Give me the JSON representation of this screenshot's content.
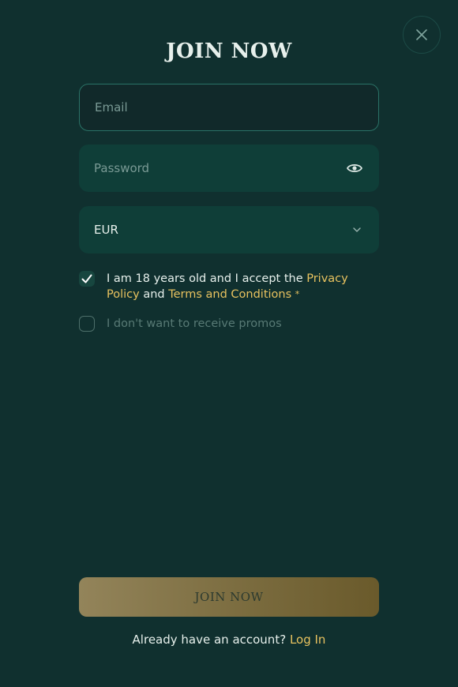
{
  "modal": {
    "title": "JOIN NOW",
    "close_icon": "close-icon"
  },
  "form": {
    "email": {
      "placeholder": "Email",
      "value": ""
    },
    "password": {
      "placeholder": "Password",
      "value": "",
      "toggle_icon": "eye-icon"
    },
    "currency": {
      "selected": "EUR",
      "chevron_icon": "chevron-down-icon"
    },
    "terms": {
      "checked": true,
      "check_icon": "checkmark-icon",
      "text_before": "I am 18 years old and I accept the ",
      "privacy_link": "Privacy Policy",
      "text_middle": " and ",
      "terms_link": "Terms and Conditions",
      "required_mark": "*"
    },
    "promos": {
      "checked": false,
      "label": "I don't want to receive promos"
    },
    "submit_label": "JOIN NOW"
  },
  "footer": {
    "prompt": "Already have an account? ",
    "login_link": "Log In"
  },
  "colors": {
    "background": "#10302f",
    "accent_gold": "#e8c25f",
    "input_bg": "#0f3e38",
    "email_border": "#2a7266",
    "text_primary": "#e7f0ec",
    "text_muted": "#587a75"
  }
}
